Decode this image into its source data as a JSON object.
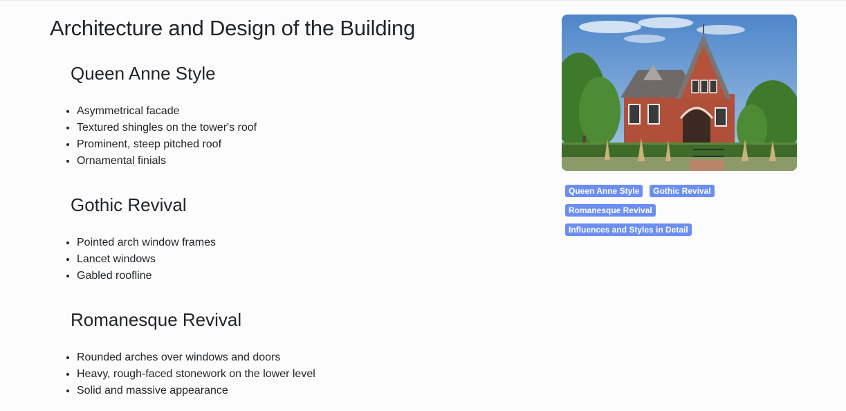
{
  "page": {
    "title": "Architecture and Design of the Building"
  },
  "sections": [
    {
      "heading": "Queen Anne Style",
      "items": [
        "Asymmetrical facade",
        "Textured shingles on the tower's roof",
        "Prominent, steep pitched roof",
        "Ornamental finials"
      ]
    },
    {
      "heading": "Gothic Revival",
      "items": [
        "Pointed arch window frames",
        "Lancet windows",
        "Gabled roofline"
      ]
    },
    {
      "heading": "Romanesque Revival",
      "items": [
        "Rounded arches over windows and doors",
        "Heavy, rough-faced stonework on the lower level",
        "Solid and massive appearance"
      ]
    }
  ],
  "tags": [
    "Queen Anne Style",
    "Gothic Revival",
    "Romanesque Revival",
    "Influences and Styles in Detail"
  ],
  "image": {
    "subject": "red brick Victorian house with steep gabled roofs"
  },
  "colors": {
    "tag_bg": "#6b8ef0",
    "text": "#212529",
    "background": "#fcfcfc"
  }
}
